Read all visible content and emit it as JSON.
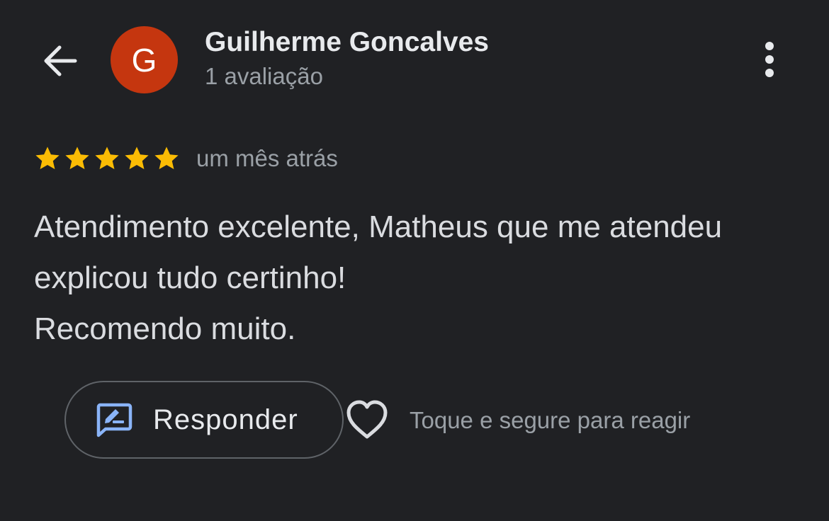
{
  "header": {
    "back_icon": "arrow-back-icon",
    "avatar_letter": "G",
    "avatar_color": "#c5360f",
    "user_name": "Guilherme Goncalves",
    "review_count": "1 avaliação",
    "menu_icon": "more-vert-icon"
  },
  "review": {
    "rating": 5,
    "rating_max": 5,
    "star_color": "#fbbc04",
    "date": "um mês atrás",
    "text_lines": [
      "Atendimento excelente, Matheus que me atendeu",
      "explicou tudo certinho!",
      "Recomendo muito."
    ]
  },
  "actions": {
    "reply_icon": "rate-review-icon",
    "reply_label": "Responder",
    "reply_icon_color": "#8ab4f8",
    "heart_icon": "heart-outline-icon",
    "react_hint": "Toque e segure para reagir"
  }
}
